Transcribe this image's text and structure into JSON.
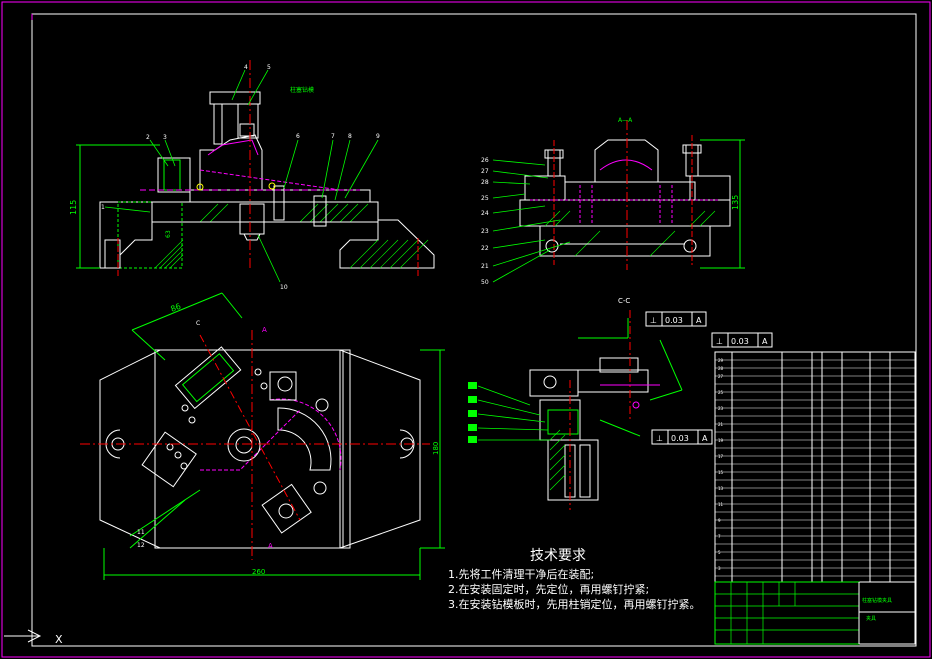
{
  "tech_requirements": {
    "title": "技术要求",
    "items": [
      "1.先将工件清理干净后在装配;",
      "2.在安装固定时，先定位，再用螺钉拧紧;",
      "3.在安装钻模板时，先用柱销定位，再用螺钉拧紧。"
    ]
  },
  "section_label": "C-C",
  "tolerance_1": {
    "symbol": "⊥",
    "value": "0.03",
    "datum": "A"
  },
  "tolerance_2": {
    "symbol": "⊥",
    "value": "0.03",
    "datum": "A"
  },
  "tolerance_3": {
    "symbol": "⊥",
    "value": "0.03",
    "datum": "A"
  },
  "dimensions": {
    "front_height": "115",
    "side_height": "135",
    "plan_width": "260",
    "plan_height": "180",
    "angle_length": "86"
  },
  "front_callouts": [
    "4",
    "5",
    "2",
    "3",
    "1",
    "6",
    "7",
    "8",
    "9",
    "10"
  ],
  "side_callouts": [
    "26",
    "27",
    "28",
    "25",
    "24",
    "23",
    "22",
    "21",
    "50"
  ],
  "plan_callouts": [
    "11",
    "12"
  ],
  "colors": {
    "background": "#000000",
    "outline": "#ffffff",
    "dimension": "#00ff00",
    "center": "#ff0000",
    "hidden": "#ff00ff",
    "frame": "#ff00ff",
    "text": "#ffffff",
    "leader": "#00ff00",
    "accent": "#ffff00"
  }
}
